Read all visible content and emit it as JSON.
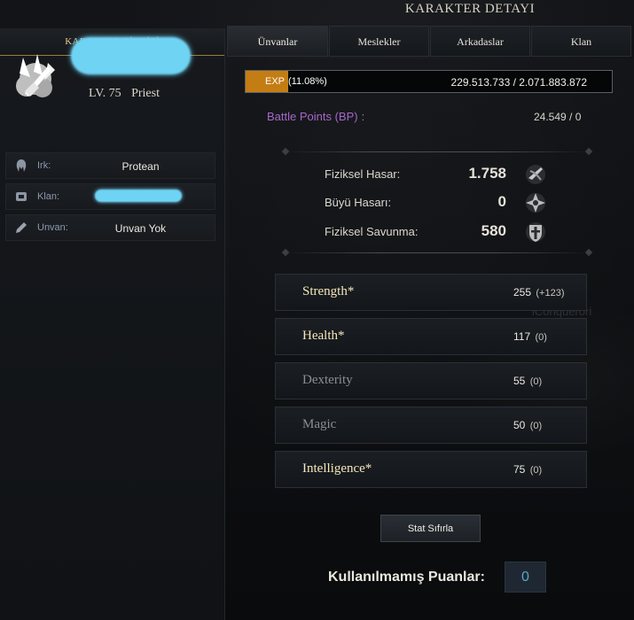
{
  "window": {
    "title": "KARAKTER DETAYI"
  },
  "left_panel": {
    "tab_label": "KARAKTER BİLGİSİ",
    "level_label": "LV. 75",
    "class_name": "Priest",
    "rows": [
      {
        "icon": "race-icon",
        "label": "Irk:",
        "value": "Protean"
      },
      {
        "icon": "clan-shield-icon",
        "label": "Klan:",
        "value": ""
      },
      {
        "icon": "pen-icon",
        "label": "Unvan:",
        "value": "Unvan Yok"
      }
    ]
  },
  "tabs": [
    {
      "label": "Ünvanlar",
      "active": true
    },
    {
      "label": "Meslekler",
      "active": false
    },
    {
      "label": "Arkadaslar",
      "active": false
    },
    {
      "label": "Klan",
      "active": false
    }
  ],
  "exp": {
    "label": "EXP",
    "percent_text": "(11.08%)",
    "fraction": 0.1108,
    "value_text": "229.513.733 / 2.071.883.872",
    "bar_color": "#c47d13"
  },
  "battle_points": {
    "label": "Battle Points (BP)",
    "colon": ":",
    "value": "24.549 / 0",
    "label_color": "#a767c9"
  },
  "combat": [
    {
      "label": "Fiziksel Hasar:",
      "value": "1.758",
      "icon": "physical-damage-icon"
    },
    {
      "label": "Büyü Hasarı:",
      "value": "0",
      "icon": "magic-damage-icon"
    },
    {
      "label": "Fiziksel Savunma:",
      "value": "580",
      "icon": "physical-defense-icon"
    }
  ],
  "stats": [
    {
      "name": "Strength*",
      "value": "255",
      "bonus": "(+123)",
      "active": true
    },
    {
      "name": "Health*",
      "value": "117",
      "bonus": "(0)",
      "active": true
    },
    {
      "name": "Dexterity",
      "value": "55",
      "bonus": "(0)",
      "active": false
    },
    {
      "name": "Magic",
      "value": "50",
      "bonus": "(0)",
      "active": false
    },
    {
      "name": "Intelligence*",
      "value": "75",
      "bonus": "(0)",
      "active": true
    }
  ],
  "reset_button": {
    "label": "Stat Sıfırla"
  },
  "unused_points": {
    "label": "Kullanılmamış Puanlar:",
    "value": "0"
  }
}
